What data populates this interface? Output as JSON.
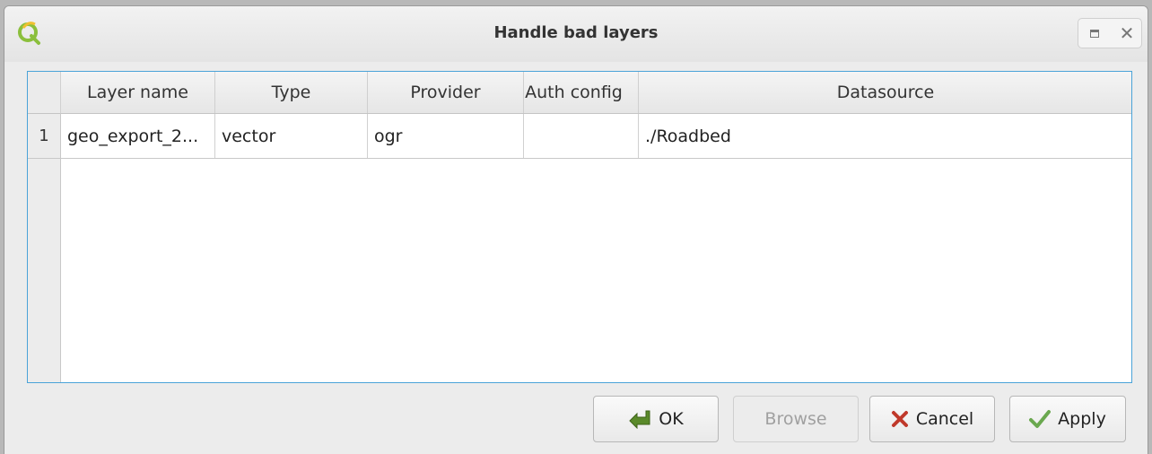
{
  "window": {
    "title": "Handle bad layers",
    "app_icon": "qgis-icon",
    "controls": {
      "maximize_icon": "maximize-icon",
      "close_icon": "close-icon",
      "close_glyph": "✕"
    }
  },
  "table": {
    "columns": [
      "Layer name",
      "Type",
      "Provider",
      "Auth config",
      "Datasource"
    ],
    "rows": [
      {
        "number": "1",
        "layer_name": "geo_export_2...",
        "type": "vector",
        "provider": "ogr",
        "auth_config": "",
        "datasource": "./Roadbed"
      }
    ]
  },
  "buttons": {
    "ok": {
      "label": "OK",
      "icon": "ok-arrow-icon"
    },
    "browse": {
      "label": "Browse",
      "disabled": true
    },
    "cancel": {
      "label": "Cancel",
      "icon": "cancel-x-icon"
    },
    "apply": {
      "label": "Apply",
      "icon": "checkmark-icon"
    }
  },
  "colors": {
    "accent": "#4aa3d8",
    "ok_icon": "#5a8a2a",
    "cancel_icon": "#c0392b",
    "apply_icon": "#6aa84f"
  }
}
